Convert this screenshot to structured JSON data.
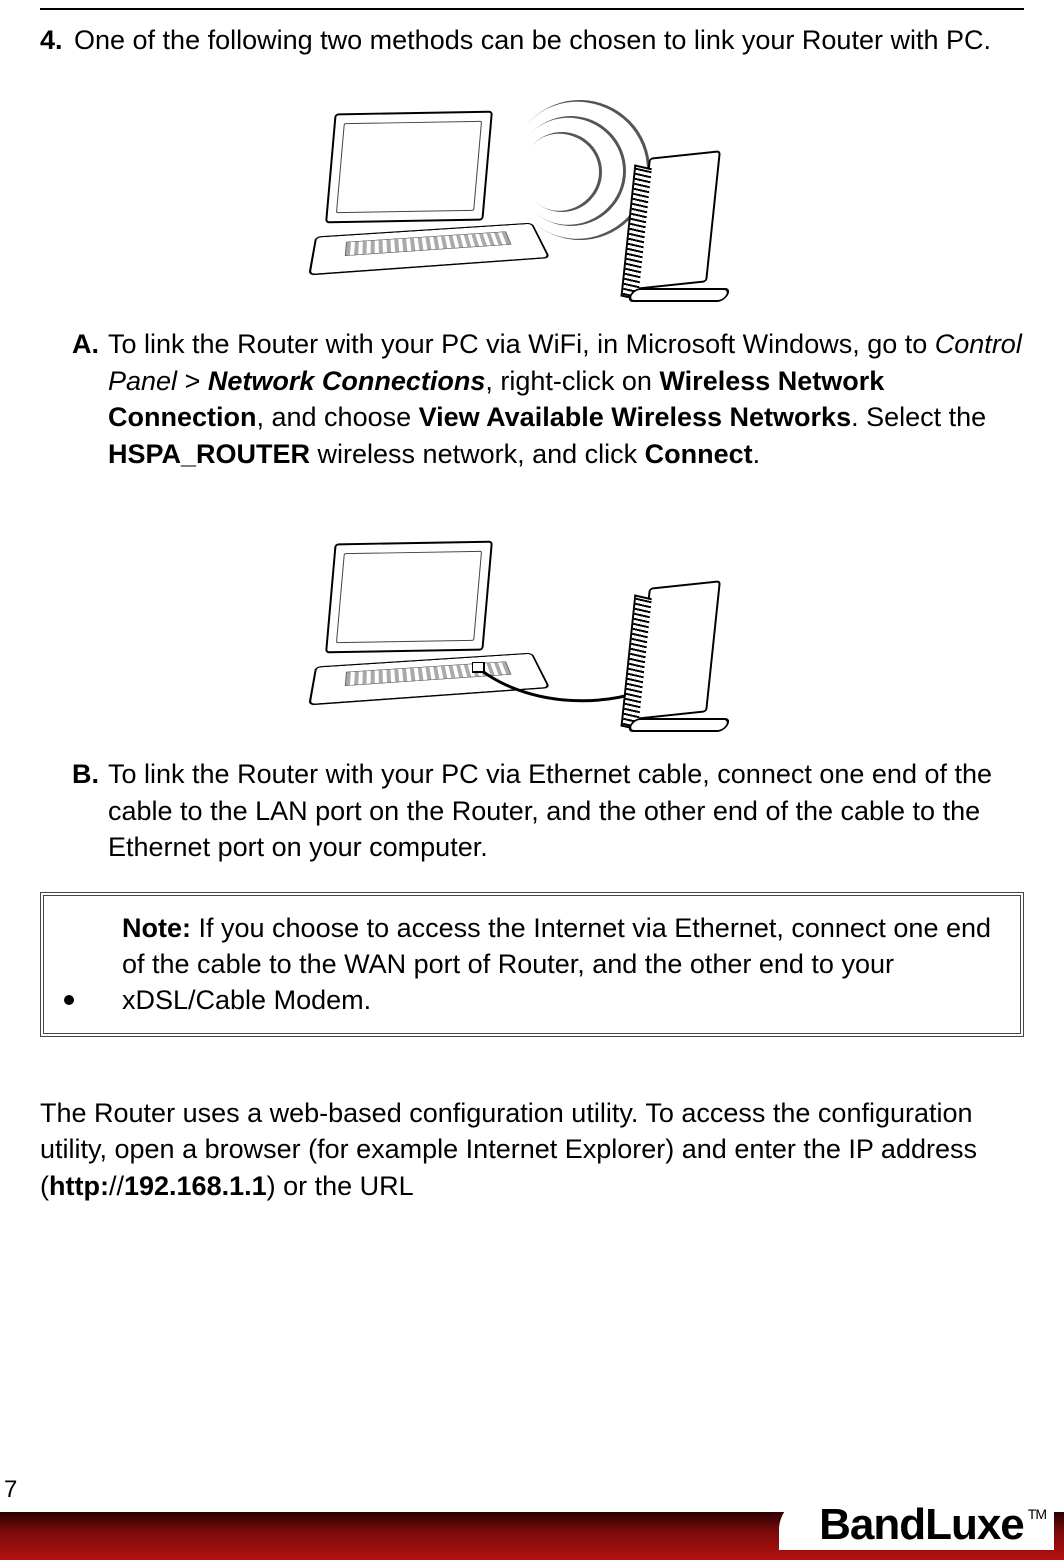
{
  "step4": {
    "number": "4.",
    "text": "One of the following two methods can be chosen to link your Router with PC."
  },
  "subA": {
    "letter": "A.",
    "p1": "To link the Router with your PC via WiFi, in Microsoft Windows, go to ",
    "control_panel": "Control Panel",
    "gt": " > ",
    "network_connections": "Network Connections",
    "p2": ", right-click on ",
    "wnc": "Wireless Network Connection",
    "p3": ", and choose ",
    "vawn": "View Available Wireless Networks",
    "p4": ". Select the ",
    "hspa": "HSPA_ROUTER",
    "p5": " wireless network, and click ",
    "connect": "Connect",
    "p6": "."
  },
  "subB": {
    "letter": "B.",
    "text": "To link the Router with your PC via Ethernet cable, connect one end of the cable to the LAN port on the Router, and the other end of the cable to the Ethernet port on your computer."
  },
  "note": {
    "label": "Note:",
    "text": " If you choose to access the Internet via Ethernet, connect one end of the cable to the WAN port of Router, and the other end to your xDSL/Cable Modem."
  },
  "final": {
    "p1": "The Router uses a web-based configuration utility. To access the configuration utility, open a browser (for example Internet Explorer) and enter the IP address (",
    "http": "http:",
    "slashes": "//",
    "ip": "192.168.1.1",
    "p2": ") or the URL"
  },
  "pagenum": "7",
  "brand": "BandLuxe",
  "tm": "TM"
}
